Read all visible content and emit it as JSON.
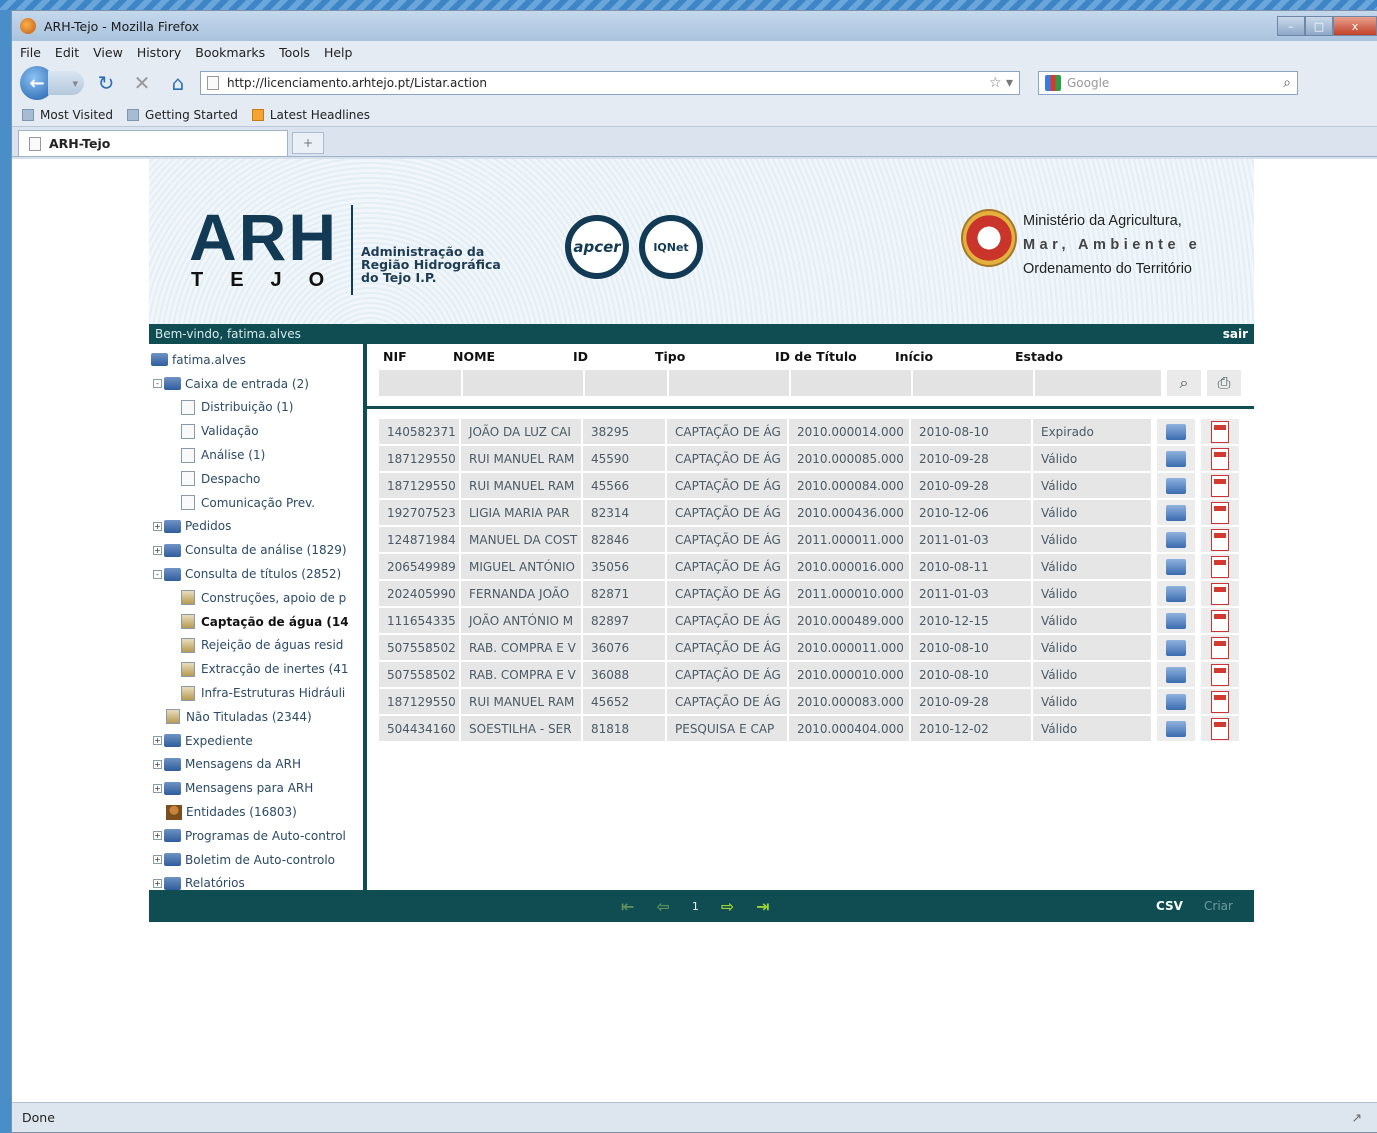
{
  "window": {
    "title": "ARH-Tejo - Mozilla Firefox",
    "controls": [
      "–",
      "□",
      "x"
    ]
  },
  "menu": [
    "File",
    "Edit",
    "View",
    "History",
    "Bookmarks",
    "Tools",
    "Help"
  ],
  "nav": {
    "url": "http://licenciamento.arhtejo.pt/Listar.action",
    "search_placeholder": "Google"
  },
  "bookmarks": [
    "Most Visited",
    "Getting Started",
    "Latest Headlines"
  ],
  "tab": {
    "title": "ARH-Tejo",
    "newtab": "+"
  },
  "header": {
    "logo_a": "ARH",
    "logo_h": "",
    "tejo": "TEJO",
    "org_line1": "Administração da",
    "org_line2": "Região Hidrográfica",
    "org_line3": "do Tejo I.P.",
    "cert1": "apcer",
    "cert2": "IQNet",
    "ministry_line1": "Ministério da Agricultura,",
    "ministry_line2": "Mar, Ambiente e",
    "ministry_line3": "Ordenamento do Território"
  },
  "welcome": {
    "text": "Bem-vindo, fatima.alves",
    "logout": "sair"
  },
  "tree": [
    {
      "label": "fatima.alves",
      "indent": 0,
      "icon": "folder",
      "exp": ""
    },
    {
      "label": "Caixa de entrada (2)",
      "indent": 1,
      "icon": "folder",
      "exp": "-"
    },
    {
      "label": "Distribuição (1)",
      "indent": 2,
      "icon": "doc",
      "exp": ""
    },
    {
      "label": "Validação",
      "indent": 2,
      "icon": "doc",
      "exp": ""
    },
    {
      "label": "Análise (1)",
      "indent": 2,
      "icon": "doc",
      "exp": ""
    },
    {
      "label": "Despacho",
      "indent": 2,
      "icon": "doc",
      "exp": ""
    },
    {
      "label": "Comunicação Prev.",
      "indent": 2,
      "icon": "doc",
      "exp": ""
    },
    {
      "label": "Pedidos",
      "indent": 1,
      "icon": "folder",
      "exp": "+"
    },
    {
      "label": "Consulta de análise (1829)",
      "indent": 1,
      "icon": "folder",
      "exp": "+"
    },
    {
      "label": "Consulta de títulos (2852)",
      "indent": 1,
      "icon": "folder",
      "exp": "-"
    },
    {
      "label": "Construções, apoio de p",
      "indent": 2,
      "icon": "img",
      "exp": ""
    },
    {
      "label": "Captação de água (14",
      "indent": 2,
      "icon": "img",
      "exp": "",
      "bold": true
    },
    {
      "label": "Rejeição de águas resid",
      "indent": 2,
      "icon": "img",
      "exp": ""
    },
    {
      "label": "Extracção de inertes (41",
      "indent": 2,
      "icon": "img",
      "exp": ""
    },
    {
      "label": "Infra-Estruturas Hidráuli",
      "indent": 2,
      "icon": "img",
      "exp": ""
    },
    {
      "label": "Não Tituladas (2344)",
      "indent": 1,
      "icon": "img",
      "exp": ""
    },
    {
      "label": "Expediente",
      "indent": 1,
      "icon": "folder",
      "exp": "+"
    },
    {
      "label": "Mensagens da ARH",
      "indent": 1,
      "icon": "folder",
      "exp": "+"
    },
    {
      "label": "Mensagens para ARH",
      "indent": 1,
      "icon": "folder",
      "exp": "+"
    },
    {
      "label": "Entidades (16803)",
      "indent": 1,
      "icon": "entity",
      "exp": ""
    },
    {
      "label": "Programas de Auto-control",
      "indent": 1,
      "icon": "folder",
      "exp": "+"
    },
    {
      "label": "Boletim de Auto-controlo",
      "indent": 1,
      "icon": "folder",
      "exp": "+"
    },
    {
      "label": "Relatórios",
      "indent": 1,
      "icon": "folder",
      "exp": "+"
    }
  ],
  "table": {
    "columns": [
      "NIF",
      "NOME",
      "ID",
      "Tipo",
      "ID de Título",
      "Início",
      "Estado"
    ],
    "rows": [
      [
        "140582371",
        "JOÃO DA LUZ CAI",
        "38295",
        "CAPTAÇÃO DE ÁG",
        "2010.000014.000",
        "2010-08-10",
        "Expirado"
      ],
      [
        "187129550",
        "RUI MANUEL RAM",
        "45590",
        "CAPTAÇÃO DE ÁG",
        "2010.000085.000",
        "2010-09-28",
        "Válido"
      ],
      [
        "187129550",
        "RUI MANUEL RAM",
        "45566",
        "CAPTAÇÃO DE ÁG",
        "2010.000084.000",
        "2010-09-28",
        "Válido"
      ],
      [
        "192707523",
        "LIGIA MARIA PAR",
        "82314",
        "CAPTAÇÃO DE ÁG",
        "2010.000436.000",
        "2010-12-06",
        "Válido"
      ],
      [
        "124871984",
        "MANUEL DA COST",
        "82846",
        "CAPTAÇÃO DE ÁG",
        "2011.000011.000",
        "2011-01-03",
        "Válido"
      ],
      [
        "206549989",
        "MIGUEL ANTÓNIO",
        "35056",
        "CAPTAÇÃO DE ÁG",
        "2010.000016.000",
        "2010-08-11",
        "Válido"
      ],
      [
        "202405990",
        "FERNANDA JOÃO",
        "82871",
        "CAPTAÇÃO DE ÁG",
        "2011.000010.000",
        "2011-01-03",
        "Válido"
      ],
      [
        "111654335",
        "JOÃO ANTÓNIO M",
        "82897",
        "CAPTAÇÃO DE ÁG",
        "2010.000489.000",
        "2010-12-15",
        "Válido"
      ],
      [
        "507558502",
        "RAB. COMPRA E V",
        "36076",
        "CAPTAÇÃO DE ÁG",
        "2010.000011.000",
        "2010-08-10",
        "Válido"
      ],
      [
        "507558502",
        "RAB. COMPRA E V",
        "36088",
        "CAPTAÇÃO DE ÁG",
        "2010.000010.000",
        "2010-08-10",
        "Válido"
      ],
      [
        "187129550",
        "RUI MANUEL RAM",
        "45652",
        "CAPTAÇÃO DE ÁG",
        "2010.000083.000",
        "2010-09-28",
        "Válido"
      ],
      [
        "504434160",
        "SOESTILHA - SER",
        "81818",
        "PESQUISA E CAP",
        "2010.000404.000",
        "2010-12-02",
        "Válido"
      ]
    ]
  },
  "pager": {
    "page": "1",
    "csv": "CSV",
    "create": "Criar"
  },
  "status": {
    "text": "Done"
  }
}
